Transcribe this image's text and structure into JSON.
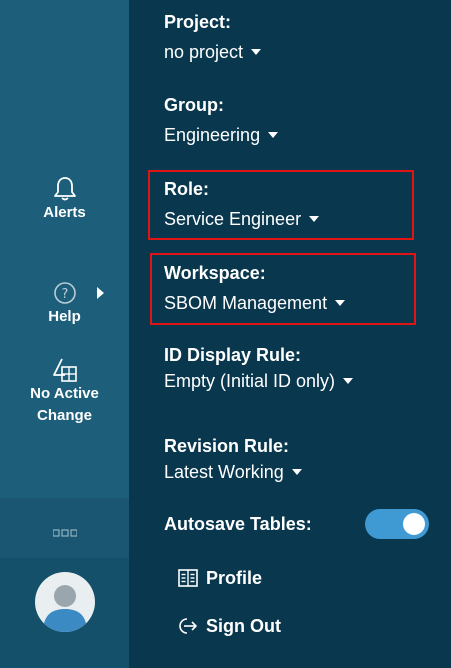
{
  "rail": {
    "alerts_label": "Alerts",
    "help_label": "Help",
    "change_label_line1": "No Active",
    "change_label_line2": "Change",
    "more_icon": "more-dots-icon",
    "avatar_icon": "user-avatar-icon"
  },
  "panel": {
    "project": {
      "label": "Project:",
      "value": "no project"
    },
    "group": {
      "label": "Group:",
      "value": "Engineering"
    },
    "role": {
      "label": "Role:",
      "value": "Service Engineer"
    },
    "workspace": {
      "label": "Workspace:",
      "value": "SBOM Management"
    },
    "id_display_rule": {
      "label": "ID Display Rule:",
      "value": "Empty (Initial ID only)"
    },
    "revision_rule": {
      "label": "Revision Rule:",
      "value": "Latest Working"
    },
    "autosave": {
      "label": "Autosave Tables:",
      "enabled": true
    },
    "profile_label": "Profile",
    "signout_label": "Sign Out"
  },
  "colors": {
    "rail_bg": "#1d5f7b",
    "panel_bg": "#08374e",
    "highlight": "#e01414",
    "toggle_on": "#3f9ad4"
  }
}
